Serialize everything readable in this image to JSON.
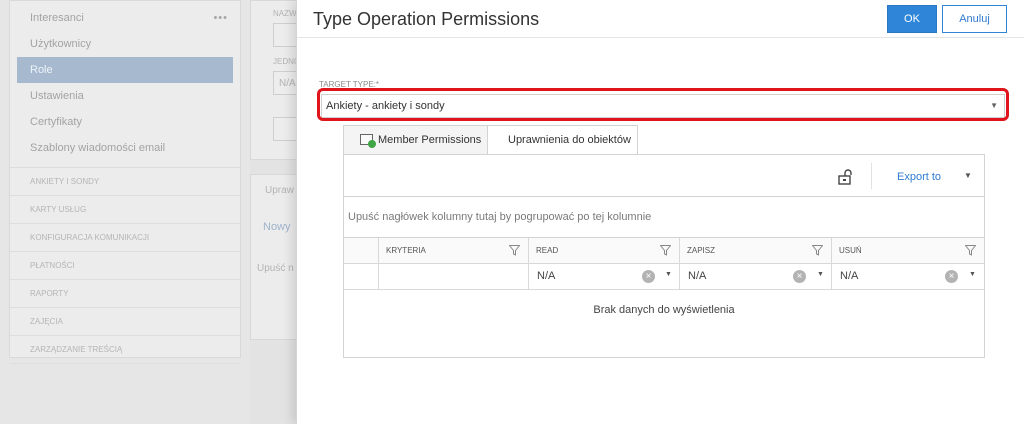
{
  "sidebar": {
    "items": [
      {
        "label": "Interesanci"
      },
      {
        "label": "Użytkownicy"
      },
      {
        "label": "Role"
      },
      {
        "label": "Ustawienia"
      },
      {
        "label": "Certyfikaty"
      },
      {
        "label": "Szablony wiadomości email"
      }
    ],
    "more_label": "•••",
    "sections": [
      {
        "label": "ANKIETY I SONDY"
      },
      {
        "label": "KARTY USŁUG"
      },
      {
        "label": "KONFIGURACJA KOMUNIKACJI"
      },
      {
        "label": "PŁATNOŚCI"
      },
      {
        "label": "RAPORTY"
      },
      {
        "label": "ZAJĘCIA"
      },
      {
        "label": "ZARZĄDZANIE TREŚCIĄ"
      }
    ]
  },
  "background": {
    "label_name": "NAZW",
    "label_unit": "JEDNO",
    "value_na": "N/A",
    "tab_label": "Upraw",
    "new_link": "Nowy",
    "drop_hint": "Upuść n"
  },
  "modal": {
    "title": "Type Operation Permissions",
    "ok_label": "OK",
    "cancel_label": "Anuluj",
    "target_type_label": "TARGET TYPE:*",
    "target_type_value": "Ankiety - ankiety i sondy"
  },
  "tabs": [
    {
      "label": "Member Permissions",
      "icon": "member-permissions-icon"
    },
    {
      "label": "Uprawnienia do obiektów"
    }
  ],
  "grid": {
    "export_label": "Export to",
    "group_hint": "Upuść nagłówek kolumny tutaj by pogrupować po tej kolumnie",
    "columns": [
      {
        "label": ""
      },
      {
        "label": "KRYTERIA"
      },
      {
        "label": "READ"
      },
      {
        "label": "ZAPISZ"
      },
      {
        "label": "USUŃ"
      }
    ],
    "filters": [
      {
        "value": ""
      },
      {
        "value": ""
      },
      {
        "value": "N/A"
      },
      {
        "value": "N/A"
      },
      {
        "value": "N/A"
      }
    ],
    "empty_message": "Brak danych do wyświetlenia"
  },
  "colors": {
    "primary": "#2f86d8",
    "highlight": "#e0141b",
    "active_nav": "#a6b9cf"
  }
}
